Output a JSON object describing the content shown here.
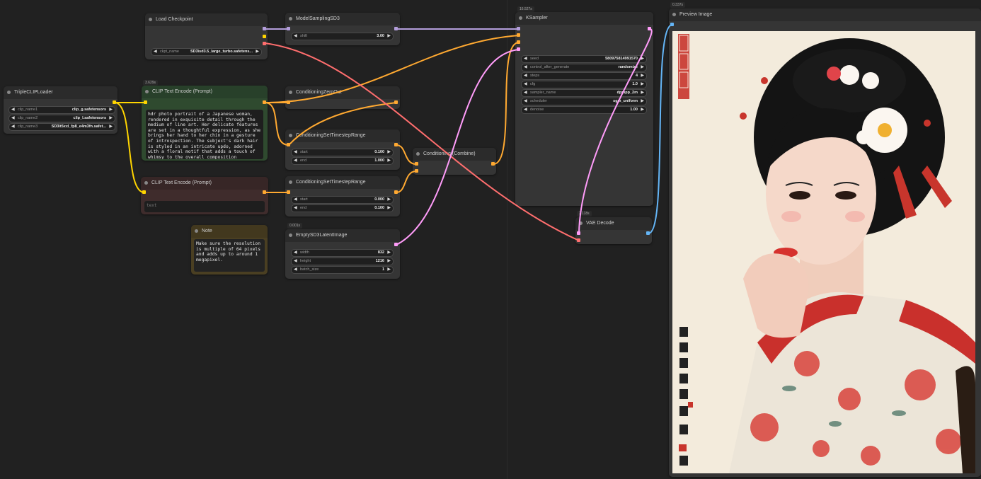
{
  "nodes": {
    "load_checkpoint": {
      "title": "Load Checkpoint",
      "ckpt_label": "ckpt_name",
      "ckpt_value": "SD3\\sd3.5_large_turbo.safetens..."
    },
    "model_sampling": {
      "title": "ModelSamplingSD3",
      "shift_label": "shift",
      "shift_value": "3.00"
    },
    "triple_clip": {
      "title": "TripleCLIPLoader",
      "rows": [
        {
          "label": "clip_name1",
          "value": "clip_g.safetensors"
        },
        {
          "label": "clip_name2",
          "value": "clip_l.safetensors"
        },
        {
          "label": "clip_name3",
          "value": "SD3\\t5xxl_fp8_e4m3fn.safet..."
        }
      ]
    },
    "clip_pos": {
      "badge": "3.629s",
      "title": "CLIP Text Encode (Prompt)",
      "text": "hdr photo portrait of a Japanese woman, rendered in exquisite detail through the medium of line art. Her delicate features are set in a thoughtful expression, as she brings her hand to her chin in a gesture of introspection. The subject's dark hair is styled in an intricate updo, adorned with a floral motif that adds a touch of whimsy to the overall composition"
    },
    "clip_neg": {
      "title": "CLIP Text Encode (Prompt)",
      "placeholder": "text"
    },
    "cond_zero": {
      "title": "ConditioningZeroOut"
    },
    "cond_ts1": {
      "title": "ConditioningSetTimestepRange",
      "start_label": "start",
      "start_value": "0.100",
      "end_label": "end",
      "end_value": "1.000"
    },
    "cond_ts2": {
      "title": "ConditioningSetTimestepRange",
      "start_label": "start",
      "start_value": "0.000",
      "end_label": "end",
      "end_value": "0.100"
    },
    "cond_combine": {
      "title": "Conditioning (Combine)"
    },
    "note": {
      "title": "Note",
      "text": "Make sure the resolution is multiple of 64 pixels and adds up to around 1 megapixel."
    },
    "latent": {
      "badge": "0.001s",
      "title": "EmptySD3LatentImage",
      "rows": [
        {
          "label": "width",
          "value": "832"
        },
        {
          "label": "height",
          "value": "1216"
        },
        {
          "label": "batch_size",
          "value": "1"
        }
      ]
    },
    "ksampler": {
      "badge": "16.527s",
      "title": "KSampler",
      "rows": [
        {
          "label": "seed",
          "value": "580975814991570"
        },
        {
          "label": "control_after_generate",
          "value": "randomize"
        },
        {
          "label": "steps",
          "value": "4"
        },
        {
          "label": "cfg",
          "value": "1.0"
        },
        {
          "label": "sampler_name",
          "value": "dpmpp_2m"
        },
        {
          "label": "scheduler",
          "value": "sgm_uniform"
        },
        {
          "label": "denoise",
          "value": "1.00"
        }
      ]
    },
    "vae_decode": {
      "badge": "2.118s",
      "title": "VAE Decode"
    },
    "preview": {
      "badge": "0.337s",
      "title": "Preview Image"
    }
  },
  "colors": {
    "canvas": "#212121",
    "node_body": "#353535",
    "model_link": "#b39ddb",
    "clip_link": "#ffd500",
    "conditioning_link": "#ffa931",
    "vae_link": "#ff6e6e",
    "latent_link": "#ff9cf9",
    "image_link": "#64b5f6",
    "clip_pos_node": "#2f4a2f",
    "clip_neg_node": "#3f2c2c",
    "note_node": "#4a3f22"
  }
}
